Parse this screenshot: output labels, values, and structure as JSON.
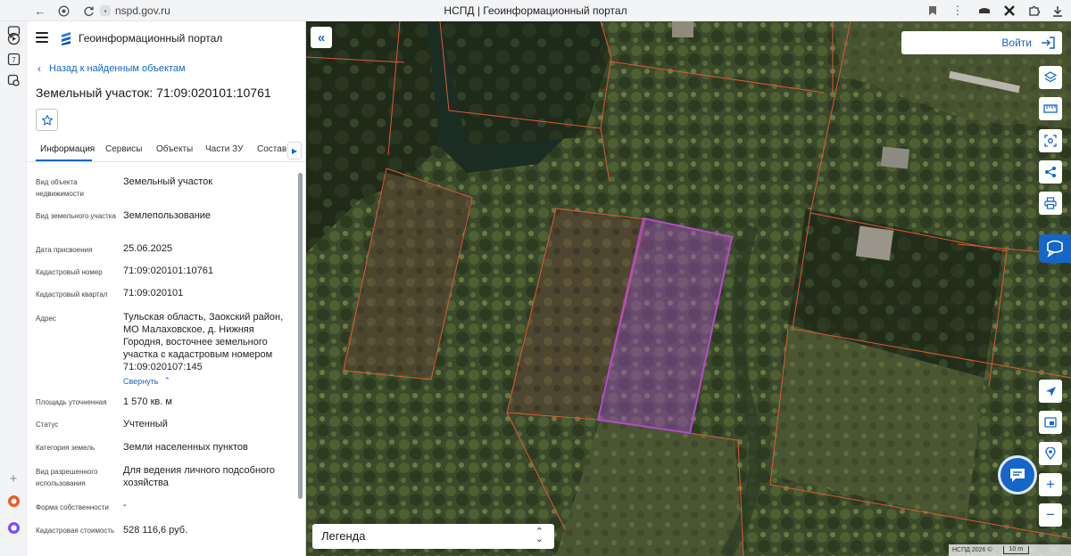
{
  "browser": {
    "address": "nspd.gov.ru",
    "window_title": "НСПД | Геоинформационный портал",
    "strip_badge": "7"
  },
  "portal": {
    "title": "Геоинформационный портал"
  },
  "panel": {
    "back_link": "Назад к найденным объектам",
    "object_title": "Земельный участок: 71:09:020101:10761",
    "tabs": [
      "Информация",
      "Сервисы",
      "Объекты",
      "Части ЗУ",
      "Состав"
    ],
    "collapse_link": "Свернуть",
    "properties": [
      {
        "label": "Вид объекта недвижимости",
        "value": "Земельный участок"
      },
      {
        "label": "Вид земельного участка",
        "value": "Землепользование"
      },
      {
        "label": "Дата присвоения",
        "value": "25.06.2025"
      },
      {
        "label": "Кадастровый номер",
        "value": "71:09:020101:10761"
      },
      {
        "label": "Кадастровый квартал",
        "value": "71:09:020101"
      },
      {
        "label": "Адрес",
        "value": "Тульская область, Заокский район, МО Малаховское, д. Нижняя Городня, восточнее земельного участка с кадастровым номером 71:09:020107:145"
      },
      {
        "label": "Площадь уточненная",
        "value": "1 570 кв. м"
      },
      {
        "label": "Статус",
        "value": "Учтенный"
      },
      {
        "label": "Категория земель",
        "value": "Земли населенных пунктов"
      },
      {
        "label": "Вид разрешенного использования",
        "value": "Для ведения личного подсобного хозяйства"
      },
      {
        "label": "Форма собственности",
        "value": "-"
      },
      {
        "label": "Кадастровая стоимость",
        "value": "528 116,6 руб."
      }
    ]
  },
  "map": {
    "login_label": "Войти",
    "legend_label": "Легенда",
    "attribution": "НСПД 2026 ©",
    "scale_label": "10 m",
    "parcel_border_color": "#e0573a",
    "selected_parcel_color": "#b34cc7",
    "tools": [
      "layers-icon",
      "ruler-icon",
      "select-area-icon",
      "share-icon",
      "print-icon"
    ],
    "nav_tools": [
      "locate-icon",
      "basemap-icon",
      "geolocation-icon"
    ],
    "zoom_in": "+",
    "zoom_out": "−"
  }
}
